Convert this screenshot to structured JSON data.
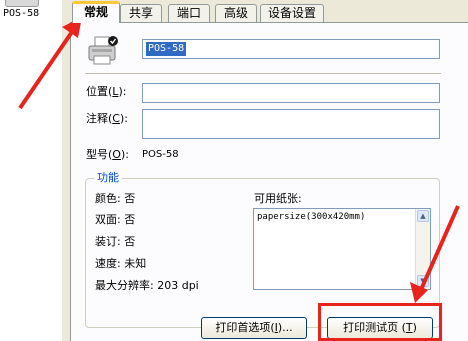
{
  "left_strip": {
    "printer_label": "POS-58"
  },
  "tabs": [
    {
      "label": "常规",
      "active": true
    },
    {
      "label": "共享",
      "active": false
    },
    {
      "label": "端口",
      "active": false
    },
    {
      "label": "高级",
      "active": false
    },
    {
      "label": "设备设置",
      "active": false
    }
  ],
  "general": {
    "printer_name": "POS-58",
    "location_label": "位置",
    "location_key": "L",
    "location_value": "",
    "comment_label": "注释",
    "comment_key": "C",
    "comment_value": "",
    "model_label": "型号",
    "model_key": "O",
    "model_value": "POS-58"
  },
  "features": {
    "title": "功能",
    "color_label": "颜色:",
    "color_value": "否",
    "duplex_label": "双面:",
    "duplex_value": "否",
    "staple_label": "装订:",
    "staple_value": "否",
    "speed_label": "速度:",
    "speed_value": "未知",
    "resolution_label": "最大分辨率:",
    "resolution_value": "203 dpi",
    "paper_label": "可用纸张:",
    "paper_items": [
      "papersize(300x420mm)"
    ]
  },
  "buttons": {
    "preferences": "打印首选项",
    "preferences_key": "I",
    "test_page": "打印测试页",
    "test_page_key": "T"
  },
  "colors": {
    "annotation": "#e8231c",
    "tab_highlight": "#ffc83c",
    "selection": "#316ac5"
  }
}
